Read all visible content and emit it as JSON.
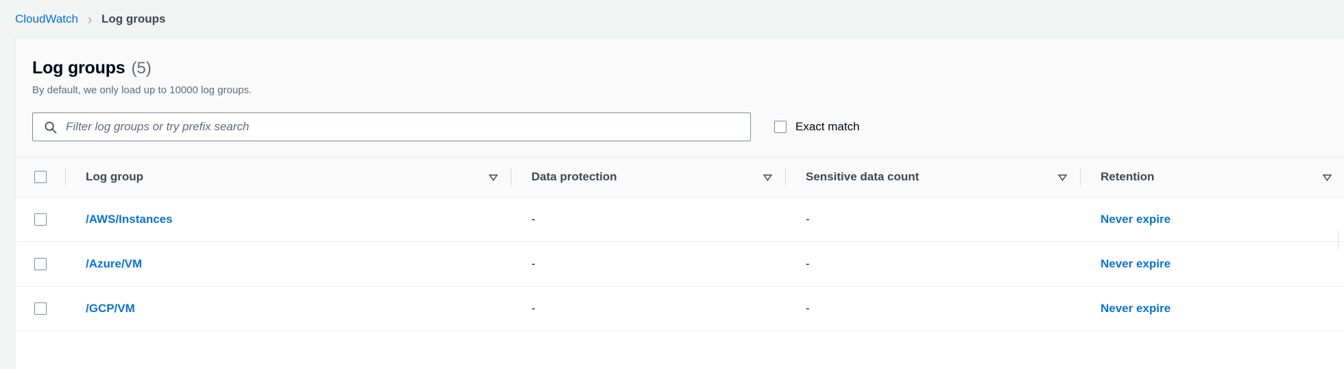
{
  "breadcrumb": {
    "root_label": "CloudWatch",
    "separator": "›",
    "current_label": "Log groups"
  },
  "panel": {
    "title": "Log groups",
    "count": "(5)",
    "subtitle": "By default, we only load up to 10000 log groups."
  },
  "search": {
    "placeholder": "Filter log groups or try prefix search",
    "value": "",
    "icon": "search-icon"
  },
  "exact_match": {
    "label": "Exact match",
    "checked": false
  },
  "table": {
    "select_all_checked": false,
    "sort_icon": "sort-descending-icon",
    "columns": [
      {
        "key": "log_group",
        "label": "Log group",
        "sortable": true
      },
      {
        "key": "data_protection",
        "label": "Data protection",
        "sortable": true
      },
      {
        "key": "sensitive_data_count",
        "label": "Sensitive data count",
        "sortable": true
      },
      {
        "key": "retention",
        "label": "Retention",
        "sortable": true
      }
    ],
    "rows": [
      {
        "checked": false,
        "log_group": "/AWS/Instances",
        "data_protection": "-",
        "sensitive_data_count": "-",
        "retention": "Never expire"
      },
      {
        "checked": false,
        "log_group": "/Azure/VM",
        "data_protection": "-",
        "sensitive_data_count": "-",
        "retention": "Never expire"
      },
      {
        "checked": false,
        "log_group": "/GCP/VM",
        "data_protection": "-",
        "sensitive_data_count": "-",
        "retention": "Never expire"
      }
    ]
  },
  "colors": {
    "link": "#0972d3",
    "page_background": "#f2f3f3",
    "card_background": "#ffffff",
    "header_background": "#fafafa",
    "border": "#e9ebed",
    "muted_text": "#5f6b7a"
  }
}
